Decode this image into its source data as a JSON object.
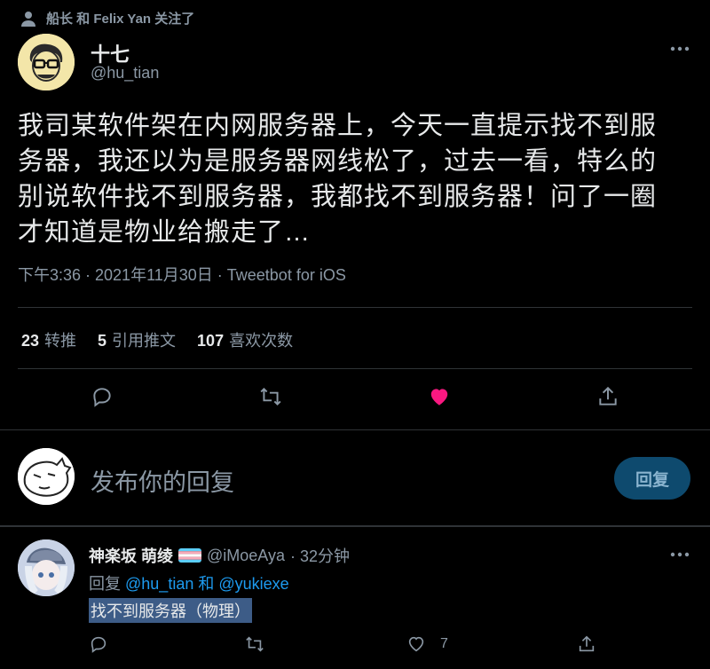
{
  "context": {
    "text": "船长 和 Felix Yan 关注了"
  },
  "tweet": {
    "author_name": "十七",
    "author_handle": "@hu_tian",
    "text_lines": [
      "我司某软件架在内网服务器上，今天一直提示找不到服",
      "务器，我还以为是服务器网线松了，过去一看，特么的",
      "别说软件找不到服务器，我都找不到服务器！问了一圈",
      "才知道是物业给搬走了…"
    ],
    "timestamp": "下午3:36 · 2021年11月30日 · Tweetbot for iOS",
    "stats": {
      "retweets_count": "23",
      "retweets_label": "转推",
      "quotes_count": "5",
      "quotes_label": "引用推文",
      "likes_count": "107",
      "likes_label": "喜欢次数"
    },
    "liked": true
  },
  "composer": {
    "placeholder": "发布你的回复",
    "reply_button": "回复"
  },
  "reply": {
    "name": "神楽坂 萌绫",
    "handle": "@iMoeAya",
    "time": "· 32分钟",
    "reply_prefix": "回复",
    "mention1": "@hu_tian",
    "and": "和",
    "mention2": "@yukiexe",
    "text": "找不到服务器（物理）",
    "likes": "7"
  },
  "colors": {
    "accent": "#1d9bf0",
    "like": "#f91880",
    "bg": "#000000",
    "muted": "#8b98a5"
  }
}
